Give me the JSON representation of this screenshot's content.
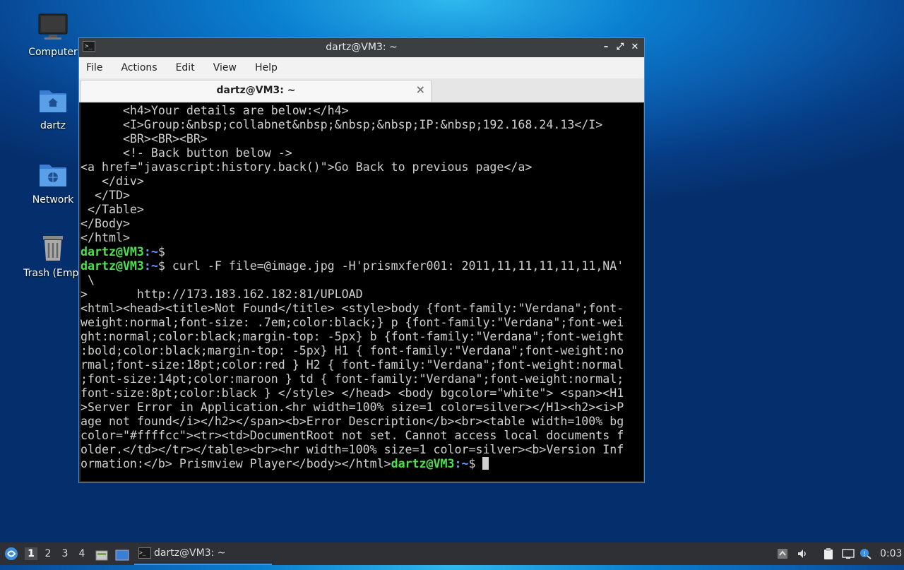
{
  "desktop": {
    "icons": [
      {
        "label": "Computer"
      },
      {
        "label": "dartz"
      },
      {
        "label": "Network"
      },
      {
        "label": "Trash (Empt"
      }
    ]
  },
  "window": {
    "title": "dartz@VM3: ~",
    "menu": [
      "File",
      "Actions",
      "Edit",
      "View",
      "Help"
    ],
    "tab_title": "dartz@VM3: ~",
    "tab_close": "×",
    "terminal_lines": [
      {
        "text": "      <h4>Your details are below:</h4>"
      },
      {
        "text": "      <I>Group:&nbsp;collabnet&nbsp;&nbsp;&nbsp;IP:&nbsp;192.168.24.13</I>"
      },
      {
        "text": "      <BR><BR><BR>"
      },
      {
        "text": "      <!- Back button below ->"
      },
      {
        "text": "<a href=\"javascript:history.back()\">Go Back to previous page</a>"
      },
      {
        "text": "   </div>"
      },
      {
        "text": "  </TD>"
      },
      {
        "text": " </Table>"
      },
      {
        "text": "</Body>"
      },
      {
        "text": "</html>"
      },
      {
        "user": "dartz@VM3",
        "path": ":~",
        "dollar": "$",
        "cmd": ""
      },
      {
        "user": "dartz@VM3",
        "path": ":~",
        "dollar": "$",
        "cmd": " curl -F file=@image.jpg -H'prismxfer001: 2011,11,11,11,11,11,NA'"
      },
      {
        "text": " \\"
      },
      {
        "text": ">       http://173.183.162.182:81/UPLOAD"
      },
      {
        "text": "<html><head><title>Not Found</title> <style>body {font-family:\"Verdana\";font-"
      },
      {
        "text": "weight:normal;font-size: .7em;color:black;} p {font-family:\"Verdana\";font-wei"
      },
      {
        "text": "ght:normal;color:black;margin-top: -5px} b {font-family:\"Verdana\";font-weight"
      },
      {
        "text": ":bold;color:black;margin-top: -5px} H1 { font-family:\"Verdana\";font-weight:no"
      },
      {
        "text": "rmal;font-size:18pt;color:red } H2 { font-family:\"Verdana\";font-weight:normal"
      },
      {
        "text": ";font-size:14pt;color:maroon } td { font-family:\"Verdana\";font-weight:normal;"
      },
      {
        "text": "font-size:8pt;color:black } </style> </head> <body bgcolor=\"white\"> <span><H1"
      },
      {
        "text": ">Server Error in Application.<hr width=100% size=1 color=silver></H1><h2><i>P"
      },
      {
        "text": "age not found</i></h2></span><b>Error Description</b><br><table width=100% bg"
      },
      {
        "text": "color=\"#ffffcc\"><tr><td>DocumentRoot not set. Cannot access local documents f"
      },
      {
        "text": "older.</td></tr></table><br><hr width=100% size=1 color=silver><b>Version Inf"
      },
      {
        "text": "ormation:</b> Prismview Player</body></html>",
        "user": "dartz@VM3",
        "path": ":~",
        "dollar": "$",
        "cmd": " ",
        "cursor": true
      }
    ]
  },
  "taskbar": {
    "workspaces": [
      "1",
      "2",
      "3",
      "4"
    ],
    "active_workspace": "1",
    "task_label": "dartz@VM3: ~",
    "clock": "0:03"
  },
  "colors": {
    "prompt_user": "#4fe050",
    "prompt_path": "#6c9cff",
    "accent": "#4d8fd6"
  }
}
